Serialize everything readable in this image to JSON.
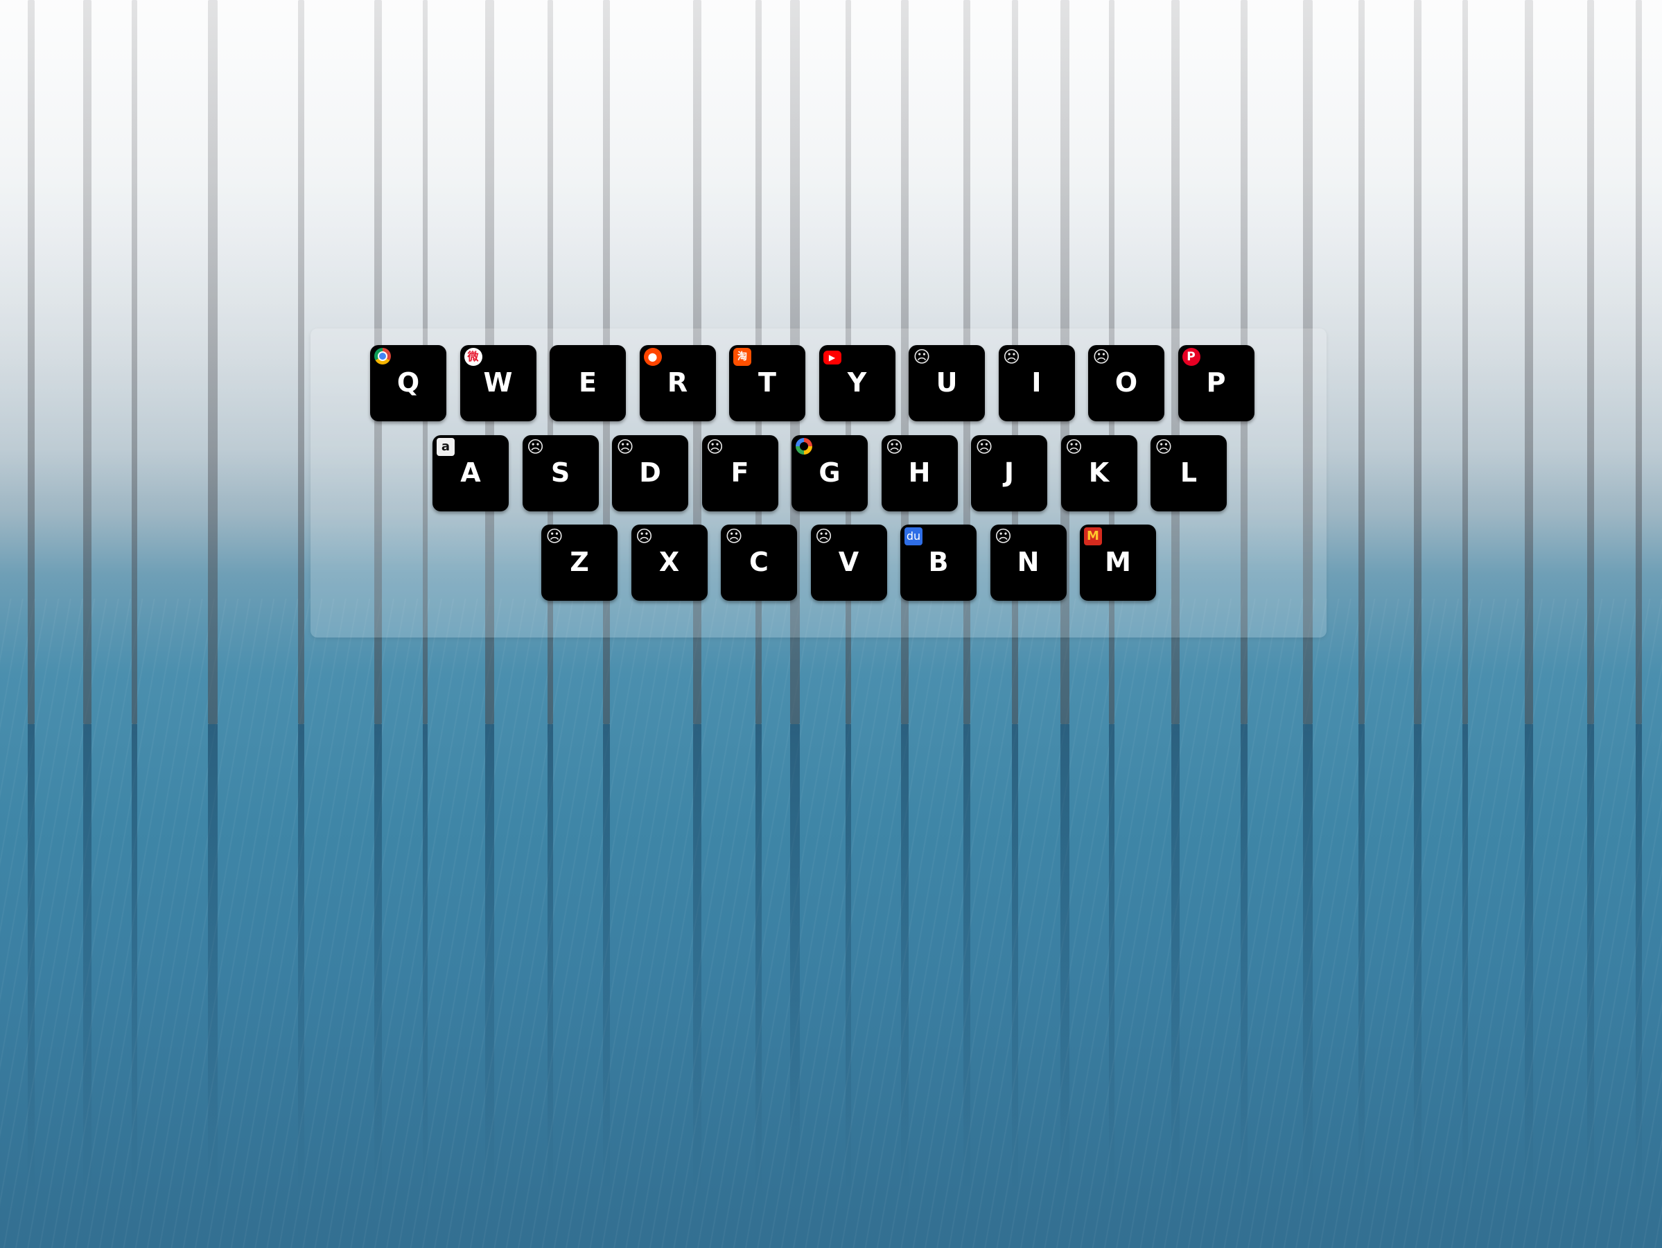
{
  "keyboard": {
    "rows": [
      [
        {
          "letter": "Q",
          "icon": "chrome-icon",
          "glyph": ""
        },
        {
          "letter": "W",
          "icon": "weibo-icon",
          "glyph": "微"
        },
        {
          "letter": "E",
          "icon": "",
          "glyph": ""
        },
        {
          "letter": "R",
          "icon": "reddit-icon",
          "glyph": "●"
        },
        {
          "letter": "T",
          "icon": "taobao-icon",
          "glyph": "淘"
        },
        {
          "letter": "Y",
          "icon": "youtube-icon",
          "glyph": "▶"
        },
        {
          "letter": "U",
          "icon": "frown-icon",
          "glyph": "☹"
        },
        {
          "letter": "I",
          "icon": "frown-icon",
          "glyph": "☹"
        },
        {
          "letter": "O",
          "icon": "frown-icon",
          "glyph": "☹"
        },
        {
          "letter": "P",
          "icon": "pinterest-icon",
          "glyph": "P"
        }
      ],
      [
        {
          "letter": "A",
          "icon": "amazon-icon",
          "glyph": "a"
        },
        {
          "letter": "S",
          "icon": "frown-icon",
          "glyph": "☹"
        },
        {
          "letter": "D",
          "icon": "frown-icon",
          "glyph": "☹"
        },
        {
          "letter": "F",
          "icon": "frown-icon",
          "glyph": "☹"
        },
        {
          "letter": "G",
          "icon": "google-icon",
          "glyph": ""
        },
        {
          "letter": "H",
          "icon": "frown-icon",
          "glyph": "☹"
        },
        {
          "letter": "J",
          "icon": "frown-icon",
          "glyph": "☹"
        },
        {
          "letter": "K",
          "icon": "frown-icon",
          "glyph": "☹"
        },
        {
          "letter": "L",
          "icon": "frown-icon",
          "glyph": "☹"
        }
      ],
      [
        {
          "letter": "Z",
          "icon": "frown-icon",
          "glyph": "☹"
        },
        {
          "letter": "X",
          "icon": "frown-icon",
          "glyph": "☹"
        },
        {
          "letter": "C",
          "icon": "frown-icon",
          "glyph": "☹"
        },
        {
          "letter": "V",
          "icon": "frown-icon",
          "glyph": "☹"
        },
        {
          "letter": "B",
          "icon": "baidu-icon",
          "glyph": "du"
        },
        {
          "letter": "N",
          "icon": "frown-icon",
          "glyph": "☹"
        },
        {
          "letter": "M",
          "icon": "mcdonalds-icon",
          "glyph": "M"
        }
      ]
    ]
  }
}
